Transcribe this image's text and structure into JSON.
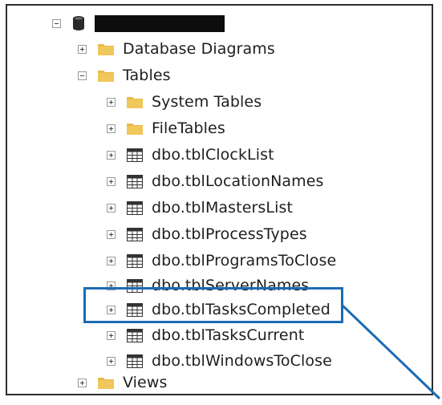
{
  "server": {
    "name_label": "",
    "icon": "database-cylinder-icon"
  },
  "nodes": {
    "database_diagrams": {
      "label": "Database Diagrams",
      "icon": "folder-icon"
    },
    "tables": {
      "label": "Tables",
      "icon": "folder-icon"
    },
    "system_tables": {
      "label": "System Tables",
      "icon": "folder-icon"
    },
    "file_tables": {
      "label": "FileTables",
      "icon": "folder-icon"
    },
    "views": {
      "label": "Views",
      "icon": "folder-icon"
    }
  },
  "tables": [
    {
      "label": "dbo.tblClockList",
      "icon": "table-grid-icon"
    },
    {
      "label": "dbo.tblLocationNames",
      "icon": "table-grid-icon"
    },
    {
      "label": "dbo.tblMastersList",
      "icon": "table-grid-icon"
    },
    {
      "label": "dbo.tblProcessTypes",
      "icon": "table-grid-icon"
    },
    {
      "label": "dbo.tblProgramsToClose",
      "icon": "table-grid-icon"
    },
    {
      "label": "dbo.tblServerNames",
      "icon": "table-grid-icon"
    },
    {
      "label": "dbo.tblTasksCompleted",
      "icon": "table-grid-icon"
    },
    {
      "label": "dbo.tblTasksCurrent",
      "icon": "table-grid-icon"
    },
    {
      "label": "dbo.tblWindowsToClose",
      "icon": "table-grid-icon"
    }
  ],
  "colors": {
    "highlight": "#1b6bb5",
    "folder": "#e8b94a",
    "frame": "#2d2d2d"
  },
  "highlighted_item": "dbo.tblTasksCompleted"
}
